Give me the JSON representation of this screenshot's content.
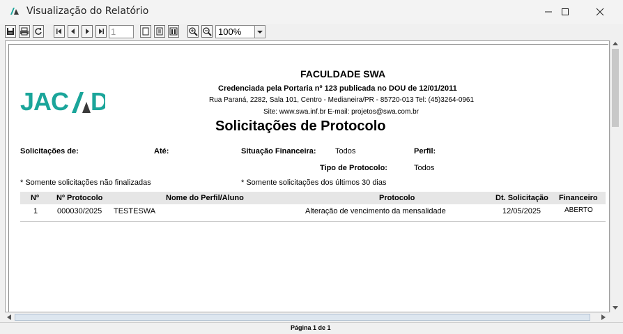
{
  "window": {
    "title": "Visualização do Relatório"
  },
  "toolbar": {
    "page_input": "1",
    "zoom": "100%"
  },
  "report": {
    "logo_text": "JACAD",
    "company": "FACULDADE SWA",
    "accreditation": "Credenciada pela Portaria nº 123 publicada no DOU de 12/01/2011",
    "address": "Rua Paraná, 2282, Sala 101, Centro - Medianeira/PR - 85720-013 Tel: (45)3264-0961",
    "contact": "Site: www.swa.inf.br   E-mail: projetos@swa.com.br",
    "title": "Solicitações de Protocolo",
    "filters": {
      "solicitacoes_label": "Solicitações de:",
      "ate_label": "Até:",
      "situacao_label": "Situação Financeira:",
      "situacao_value": "Todos",
      "perfil_label": "Perfil:",
      "tipo_label": "Tipo de Protocolo:",
      "tipo_value": "Todos"
    },
    "notes": {
      "not_finished": "* Somente solicitações não finalizadas",
      "last_30": "* Somente solicitações dos últimos 30 dias"
    },
    "table": {
      "headers": [
        "Nº",
        "Nº Protocolo",
        "Nome do Perfil/Aluno",
        "Protocolo",
        "Dt. Solicitação",
        "Financeiro"
      ],
      "rows": [
        [
          "1",
          "000030/2025",
          "TESTESWA",
          "Alteração de vencimento da mensalidade",
          "12/05/2025",
          "ABERTO"
        ]
      ]
    }
  },
  "status": {
    "page_label": "Página 1 de 1"
  },
  "colors": {
    "logo_dark": "#3a3a3a",
    "logo_accent": "#1aa59a",
    "table_header_bg": "#e6e6e6"
  }
}
